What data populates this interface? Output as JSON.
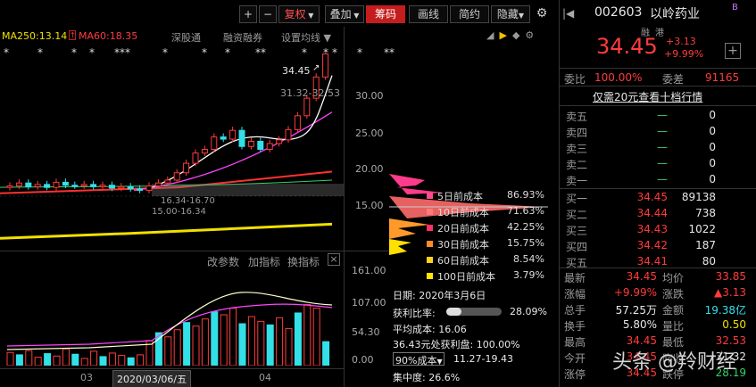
{
  "toolbar": {
    "plus": "+",
    "minus": "−",
    "fuquan": "复权",
    "diejia": "叠加",
    "chouma": "筹码",
    "huaxian": "画线",
    "jianyue": "简约",
    "yincang": "隐藏"
  },
  "ma": {
    "ma250": "MA250:13.14",
    "ma60": "MA60:18.35",
    "shencan": "深股通",
    "rongzi": "融资融券",
    "settings": "设置均线"
  },
  "stars": [
    "*",
    "*",
    "*",
    "*",
    "***",
    "*",
    "*",
    "*",
    "**",
    "*",
    "*",
    "*",
    "*",
    "**"
  ],
  "price_labels": {
    "high": "34.45",
    "range": "31.32-32.53",
    "cost_range": "16.34-16.70",
    "cost_range2": "15.00-16.34"
  },
  "axis_main": [
    "30.00",
    "25.00",
    "20.00",
    "15.00"
  ],
  "legend": [
    {
      "name": "5日前成本",
      "pct": "86.93%",
      "color": "#ff4b8b"
    },
    {
      "name": "10日前成本",
      "pct": "71.63%",
      "color": "#ff7a7a"
    },
    {
      "name": "20日前成本",
      "pct": "42.25%",
      "color": "#ff2f6a"
    },
    {
      "name": "30日前成本",
      "pct": "15.75%",
      "color": "#ff8a2a"
    },
    {
      "name": "60日前成本",
      "pct": "8.54%",
      "color": "#ffd21a"
    },
    {
      "name": "100日前成本",
      "pct": "3.79%",
      "color": "#ffe600"
    }
  ],
  "indicator_menu": {
    "a": "改参数",
    "b": "加指标",
    "c": "换指标",
    "close": "×"
  },
  "axis_vol": [
    "161.00",
    "107.00",
    "54.30",
    "0.00"
  ],
  "xaxis": {
    "m3": "03",
    "date": "2020/03/06/五",
    "m4": "04"
  },
  "chip": {
    "date": "日期: 2020年3月6日",
    "profit_label": "获利比率:",
    "profit": "28.09%",
    "avg": "平均成本: 16.06",
    "profit_disk": "36.43元处获利盘: 100.00%",
    "select": "90%成本",
    "range": "11.27-19.43",
    "concentration": "集中度: 26.6%"
  },
  "stock": {
    "code": "002603",
    "name": "以岭药业",
    "badge": "B",
    "rong": "融",
    "gang": "港",
    "price": "34.45",
    "chg": "+3.13",
    "pct": "+9.99%",
    "add": "+"
  },
  "wb": {
    "l1": "委比",
    "v1": "100.00%",
    "l2": "委差",
    "v2": "91165",
    "ad": "仅需20元查看十档行情"
  },
  "sells": [
    {
      "k": "卖五",
      "p": "—",
      "v": "0"
    },
    {
      "k": "卖四",
      "p": "—",
      "v": "0"
    },
    {
      "k": "卖三",
      "p": "—",
      "v": "0"
    },
    {
      "k": "卖二",
      "p": "—",
      "v": "0"
    },
    {
      "k": "卖一",
      "p": "—",
      "v": "0"
    }
  ],
  "buys": [
    {
      "k": "买一",
      "p": "34.45",
      "v": "89138"
    },
    {
      "k": "买二",
      "p": "34.44",
      "v": "738"
    },
    {
      "k": "买三",
      "p": "34.43",
      "v": "1022"
    },
    {
      "k": "买四",
      "p": "34.42",
      "v": "187"
    },
    {
      "k": "买五",
      "p": "34.41",
      "v": "80"
    }
  ],
  "stats": [
    {
      "l1": "最新",
      "v1": "34.45",
      "c1": "#ff3b3b",
      "l2": "均价",
      "v2": "33.85",
      "c2": "#ff3b3b"
    },
    {
      "l1": "涨幅",
      "v1": "+9.99%",
      "c1": "#ff3b3b",
      "l2": "涨跌",
      "v2": "▲3.13",
      "c2": "#ff3b3b"
    },
    {
      "l1": "总手",
      "v1": "57.25万",
      "c1": "#e8e8e8",
      "l2": "金额",
      "v2": "19.38亿",
      "c2": "#33e0e8"
    },
    {
      "l1": "换手",
      "v1": "5.80%",
      "c1": "#e8e8e8",
      "l2": "量比",
      "v2": "0.50",
      "c2": "#f0e000"
    },
    {
      "l1": "最高",
      "v1": "34.45",
      "c1": "#ff3b3b",
      "l2": "最低",
      "v2": "32.53",
      "c2": "#ff3b3b"
    },
    {
      "l1": "今开",
      "v1": "34.45",
      "c1": "#ff3b3b",
      "l2": "昨收",
      "v2": "31.32",
      "c2": "#e8e8e8"
    },
    {
      "l1": "涨停",
      "v1": "34.45",
      "c1": "#ff3b3b",
      "l2": "跌停",
      "v2": "28.19",
      "c2": "#2fd66a"
    }
  ],
  "watermark": "头条 @羚财经",
  "colors": {
    "up": "#ff3b3b",
    "down": "#33e0e8",
    "accent": "#c51d1d"
  }
}
